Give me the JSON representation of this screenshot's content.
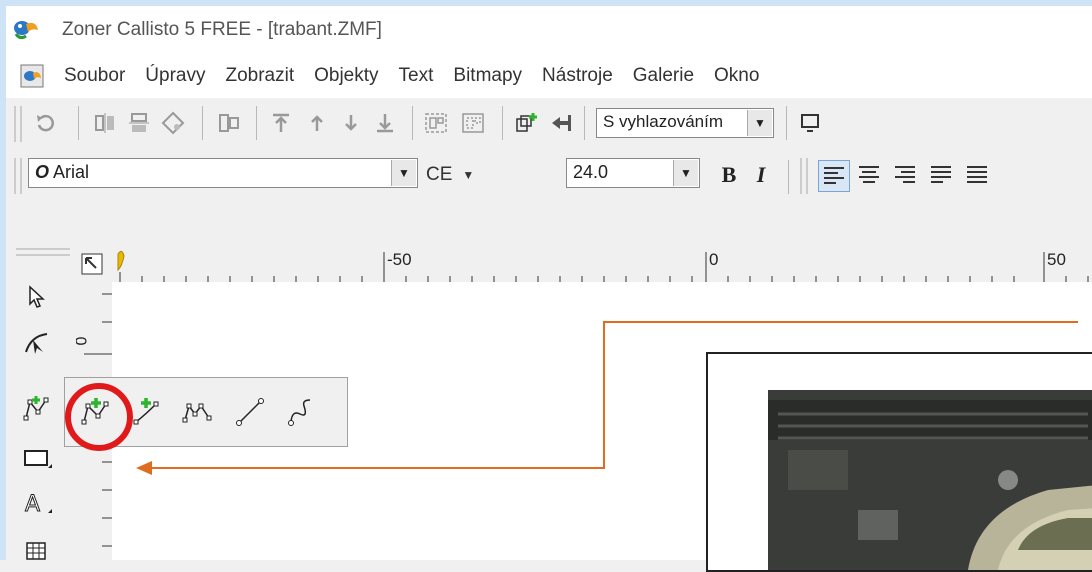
{
  "window": {
    "title": "Zoner Callisto 5 FREE - [trabant.ZMF]"
  },
  "menu": [
    "Soubor",
    "Úpravy",
    "Zobrazit",
    "Objekty",
    "Text",
    "Bitmapy",
    "Nástroje",
    "Galerie",
    "Okno"
  ],
  "toolbar1": {
    "smoothing_combo": "S vyhlazováním"
  },
  "toolbar2": {
    "font_style_marker": "O",
    "font_name": "Arial",
    "charset": "CE",
    "font_size": "24.0",
    "bold": "B",
    "italic": "I"
  },
  "ruler": {
    "labels": [
      "-50",
      "0",
      "50"
    ],
    "left_label": "0"
  },
  "colors": {
    "frame": "#cfe3f6",
    "highlight_circle": "#e0191b",
    "annotation_arrow": "#e06c1f",
    "node_add": "#2cb52c"
  },
  "icons": {
    "toolbox": [
      "pointer-icon",
      "shape-edit-icon",
      "node-add-icon",
      "rectangle-icon",
      "text-icon",
      "table-icon"
    ],
    "flyout": [
      "node-add-icon",
      "line-add-icon",
      "node-delete-icon",
      "to-line-icon",
      "to-curve-icon"
    ]
  }
}
